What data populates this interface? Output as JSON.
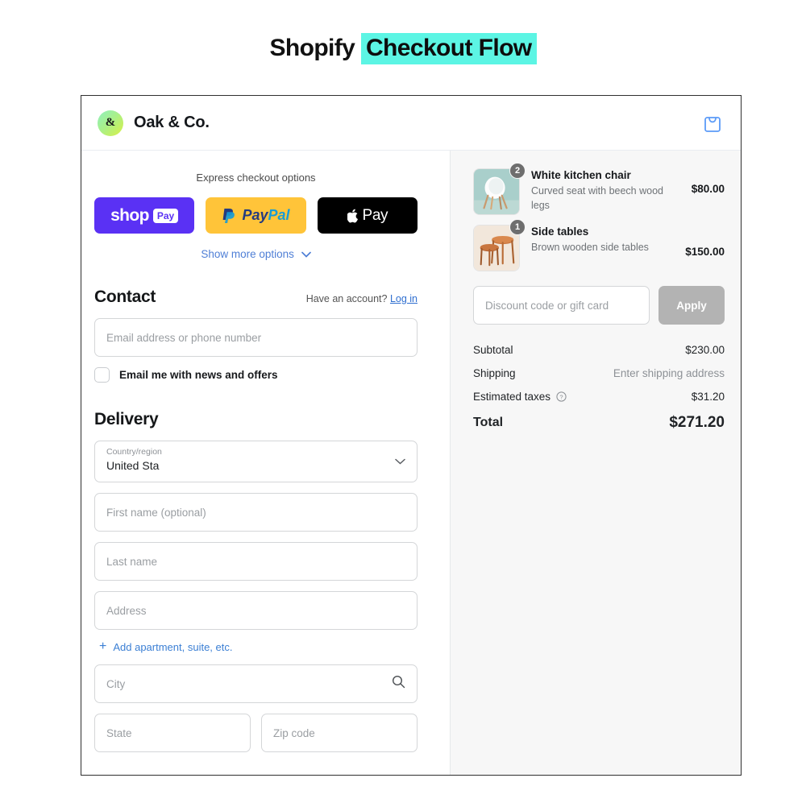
{
  "title": {
    "plain": "Shopify ",
    "highlight": "Checkout Flow",
    "highlight_color": "#5CF5E4"
  },
  "store": {
    "logo_glyph": "&",
    "name": "Oak & Co.",
    "cart_icon": "shopping-bag-icon",
    "cart_icon_color": "#5B9BF8"
  },
  "express": {
    "label": "Express checkout options",
    "buttons": [
      {
        "id": "shop-pay",
        "word": "shop",
        "chip": "Pay",
        "bg": "#5A31F4"
      },
      {
        "id": "paypal",
        "word_a": "Pay",
        "word_b": "Pal",
        "bg": "#FFC439"
      },
      {
        "id": "apple-pay",
        "text": "Pay",
        "bg": "#000000"
      }
    ],
    "show_more": "Show more options"
  },
  "contact": {
    "heading": "Contact",
    "account_prompt": "Have an account?",
    "login_label": "Log in",
    "email_placeholder": "Email address or phone number",
    "email_value": "",
    "newsletter_label": "Email me with news and offers",
    "newsletter_checked": false
  },
  "delivery": {
    "heading": "Delivery",
    "country_label": "Country/region",
    "country_value": "United Sta",
    "first_name_placeholder": "First name (optional)",
    "last_name_placeholder": "Last name",
    "address_placeholder": "Address",
    "add_apartment_label": "Add apartment, suite, etc.",
    "city_placeholder": "City",
    "state_placeholder": "State",
    "zip_placeholder": "Zip code"
  },
  "summary": {
    "items": [
      {
        "title": "White kitchen chair",
        "description": "Curved seat with beech wood legs",
        "price": "$80.00",
        "qty": "2",
        "thumb_bg": "#a8cfcb"
      },
      {
        "title": "Side tables",
        "description": "Brown wooden side tables",
        "price": "$150.00",
        "qty": "1",
        "thumb_bg": "#f0e4d8"
      }
    ],
    "discount_placeholder": "Discount code or gift card",
    "discount_value": "",
    "apply_label": "Apply",
    "subtotal_label": "Subtotal",
    "subtotal_value": "$230.00",
    "shipping_label": "Shipping",
    "shipping_value": "Enter shipping address",
    "taxes_label": "Estimated taxes",
    "taxes_info_icon": "question-circle-icon",
    "taxes_value": "$31.20",
    "total_label": "Total",
    "total_value": "$271.20"
  }
}
